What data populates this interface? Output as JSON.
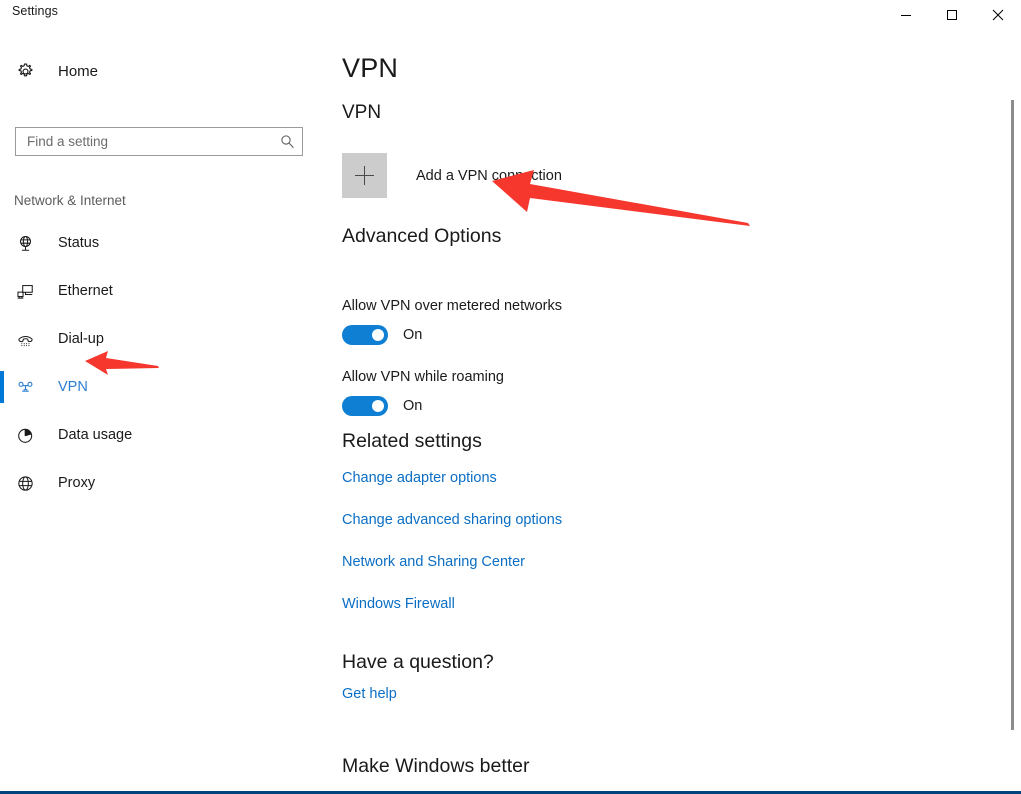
{
  "window": {
    "title": "Settings",
    "controls": [
      {
        "name": "minimize",
        "glyph": "minimize-icon",
        "label": "Minimize"
      },
      {
        "name": "maximize",
        "glyph": "maximize-icon",
        "label": "Maximize"
      },
      {
        "name": "close",
        "glyph": "close-icon",
        "label": "Close"
      }
    ]
  },
  "sidebar": {
    "home_label": "Home",
    "home_icon": "gear-icon",
    "search": {
      "placeholder": "Find a setting",
      "value": "",
      "icon": "search-icon"
    },
    "category_label": "Network & Internet",
    "items": [
      {
        "label": "Status",
        "icon": "network-status-icon",
        "selected": false
      },
      {
        "label": "Ethernet",
        "icon": "ethernet-icon",
        "selected": false
      },
      {
        "label": "Dial-up",
        "icon": "dialup-phone-icon",
        "selected": false
      },
      {
        "label": "VPN",
        "icon": "vpn-icon",
        "selected": true
      },
      {
        "label": "Data usage",
        "icon": "pie-chart-icon",
        "selected": false
      },
      {
        "label": "Proxy",
        "icon": "globe-icon",
        "selected": false
      }
    ]
  },
  "main": {
    "page_title": "VPN",
    "vpn_section": {
      "heading": "VPN",
      "add_button_label": "Add a VPN connection",
      "add_button_icon": "plus-icon"
    },
    "advanced": {
      "heading": "Advanced Options",
      "toggles": [
        {
          "caption": "Allow VPN over metered networks",
          "state": "On",
          "on": true
        },
        {
          "caption": "Allow VPN while roaming",
          "state": "On",
          "on": true
        }
      ]
    },
    "related": {
      "heading": "Related settings",
      "links": [
        "Change adapter options",
        "Change advanced sharing options",
        "Network and Sharing Center",
        "Windows Firewall"
      ]
    },
    "question": {
      "heading": "Have a question?",
      "link": "Get help"
    },
    "feedback": {
      "heading": "Make Windows better"
    }
  },
  "annotations": [
    {
      "name": "arrow-to-add-vpn-connection",
      "color": "#f5372e"
    },
    {
      "name": "arrow-to-vpn-sidebar-item",
      "color": "#f5372e"
    }
  ],
  "colors": {
    "accent": "#0078d7",
    "link": "#0b6ec4",
    "selected_text": "#2b7fd4",
    "toggle_on": "#0f7fd4",
    "annotation_red": "#f5372e",
    "window_border": "#01437c"
  }
}
